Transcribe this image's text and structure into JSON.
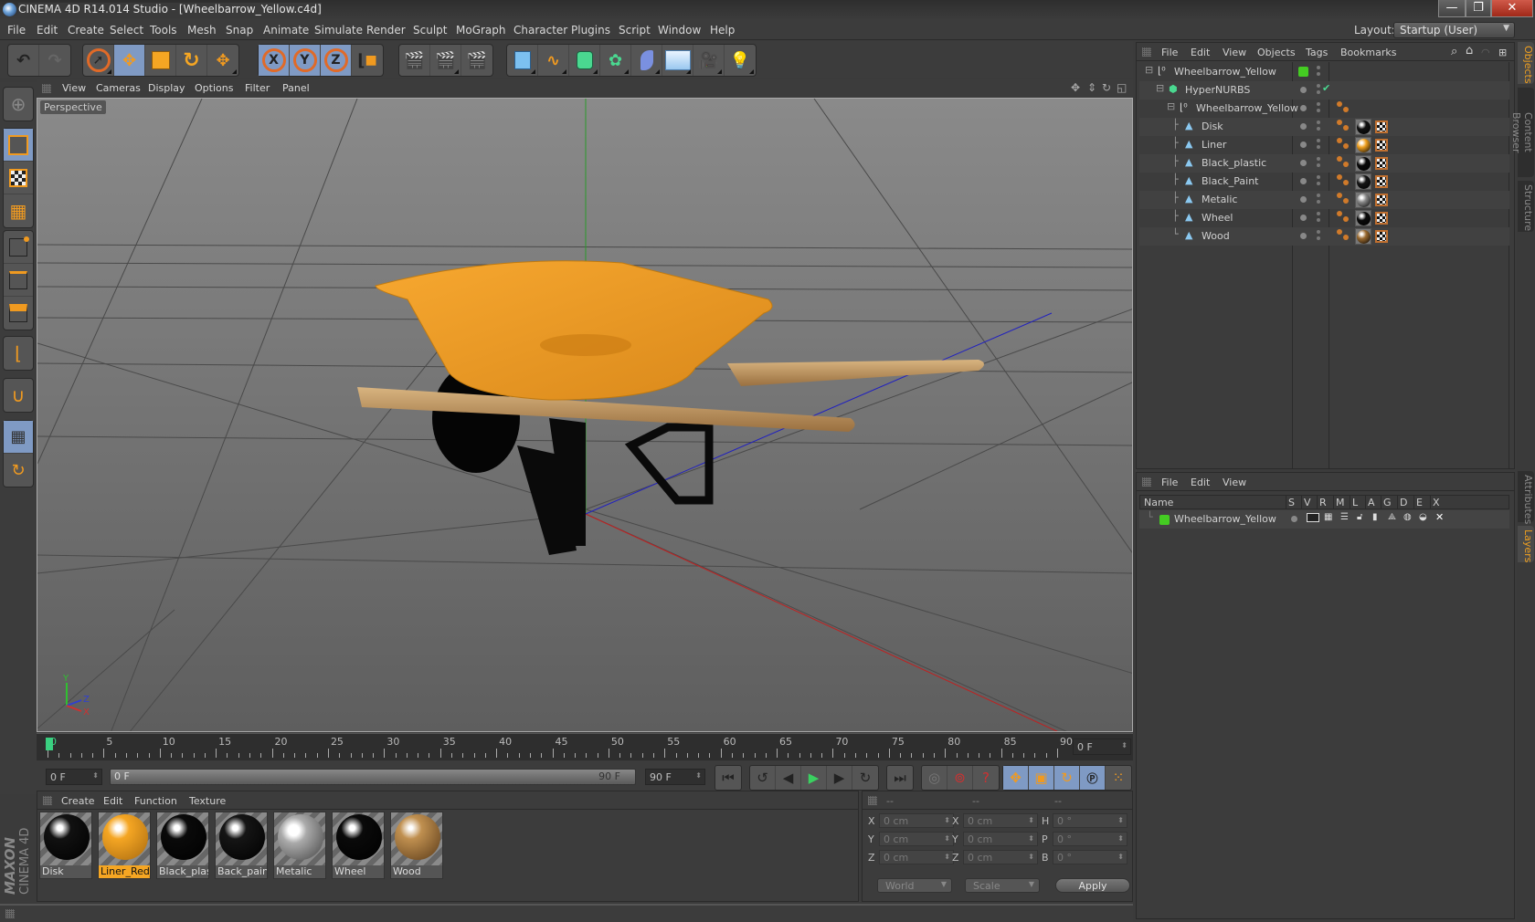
{
  "window": {
    "title": "CINEMA 4D R14.014 Studio - [Wheelbarrow_Yellow.c4d]",
    "buttons": {
      "minimize": "—",
      "maximize": "❐",
      "close": "✕"
    }
  },
  "menubar": {
    "items": [
      "File",
      "Edit",
      "Create",
      "Select",
      "Tools",
      "Mesh",
      "Snap",
      "Animate",
      "Simulate",
      "Render",
      "Sculpt",
      "MoGraph",
      "Character",
      "Plugins",
      "Script",
      "Window",
      "Help"
    ],
    "layout_label": "Layout:",
    "layout_value": "Startup (User)"
  },
  "toolbar": {
    "icons": [
      "undo-icon",
      "redo-icon",
      "live-selection-icon",
      "move-icon",
      "scale-icon",
      "rotate-icon",
      "recent-tool-icon",
      "x-axis-lock-icon",
      "y-axis-lock-icon",
      "z-axis-lock-icon",
      "coordinate-system-icon",
      "render-view-icon",
      "render-picture-viewer-icon",
      "edit-render-settings-icon",
      "cube-icon",
      "spline-icon",
      "hypernurbs-icon",
      "array-icon",
      "deformer-icon",
      "floor-icon",
      "camera-icon",
      "light-icon"
    ],
    "axis_labels": [
      "X",
      "Y",
      "Z"
    ]
  },
  "left_toolbar": {
    "icons": [
      "make-editable-icon",
      "model-mode-icon",
      "texture-mode-icon",
      "workplane-mode-icon",
      "points-mode-icon",
      "edges-mode-icon",
      "polygons-mode-icon",
      "axis-mode-icon",
      "snap-magnet-icon",
      "workplane-lock-icon",
      "workplane-rotate-icon"
    ]
  },
  "viewport": {
    "menu": [
      "View",
      "Cameras",
      "Display",
      "Options",
      "Filter",
      "Panel"
    ],
    "label": "Perspective",
    "axis_gizmo": {
      "y": "Y",
      "z": "Z",
      "x": "X"
    }
  },
  "timeline": {
    "ticks": [
      "0",
      "5",
      "10",
      "15",
      "20",
      "25",
      "30",
      "35",
      "40",
      "45",
      "50",
      "55",
      "60",
      "65",
      "70",
      "75",
      "80",
      "85",
      "90"
    ],
    "current_frame": "0 F"
  },
  "transport": {
    "start_field": "0 F",
    "range_start": "0 F",
    "range_end": "90 F",
    "end_field": "90 F"
  },
  "material_manager": {
    "menu": [
      "Create",
      "Edit",
      "Function",
      "Texture"
    ],
    "materials": [
      {
        "name": "Disk",
        "color": "#111111",
        "selected": false
      },
      {
        "name": "Liner_Red_(",
        "color": "#f0a020",
        "selected": true
      },
      {
        "name": "Black_plast",
        "color": "#0a0a0a",
        "selected": false
      },
      {
        "name": "Back_paint",
        "color": "#151515",
        "selected": false
      },
      {
        "name": "Metalic",
        "color": "#8a8a8a",
        "selected": false
      },
      {
        "name": "Wheel",
        "color": "#0a0a0a",
        "selected": false
      },
      {
        "name": "Wood",
        "color": "#9a6a30",
        "selected": false
      }
    ]
  },
  "coordinates": {
    "headers": [
      "--",
      "--",
      "--"
    ],
    "rows": [
      {
        "l1": "X",
        "v1": "0 cm",
        "l2": "X",
        "v2": "0 cm",
        "l3": "H",
        "v3": "0 °"
      },
      {
        "l1": "Y",
        "v1": "0 cm",
        "l2": "Y",
        "v2": "0 cm",
        "l3": "P",
        "v3": "0 °"
      },
      {
        "l1": "Z",
        "v1": "0 cm",
        "l2": "Z",
        "v2": "0 cm",
        "l3": "B",
        "v3": "0 °"
      }
    ],
    "mode": "World",
    "type": "Scale",
    "apply": "Apply"
  },
  "object_manager": {
    "menu": [
      "File",
      "Edit",
      "View",
      "Objects",
      "Tags",
      "Bookmarks"
    ],
    "objects": [
      {
        "name": "Wheelbarrow_Yellow",
        "type": "null",
        "depth": 0
      },
      {
        "name": "HyperNURBS",
        "type": "hypernurbs",
        "depth": 1
      },
      {
        "name": "Wheelbarrow_Yellow",
        "type": "null",
        "depth": 2
      },
      {
        "name": "Disk",
        "type": "polygon",
        "depth": 3,
        "mat": "#111111"
      },
      {
        "name": "Liner",
        "type": "polygon",
        "depth": 3,
        "mat": "#f0a020"
      },
      {
        "name": "Black_plastic",
        "type": "polygon",
        "depth": 3,
        "mat": "#0a0a0a"
      },
      {
        "name": "Black_Paint",
        "type": "polygon",
        "depth": 3,
        "mat": "#151515"
      },
      {
        "name": "Metalic",
        "type": "polygon",
        "depth": 3,
        "mat": "#8a8a8a"
      },
      {
        "name": "Wheel",
        "type": "polygon",
        "depth": 3,
        "mat": "#0a0a0a"
      },
      {
        "name": "Wood",
        "type": "polygon",
        "depth": 3,
        "mat": "#9a6a30"
      }
    ]
  },
  "layer_manager": {
    "menu": [
      "File",
      "Edit",
      "View"
    ],
    "columns": [
      "Name",
      "S",
      "V",
      "R",
      "M",
      "L",
      "A",
      "G",
      "D",
      "E",
      "X"
    ],
    "layers": [
      {
        "name": "Wheelbarrow_Yellow",
        "color": "#44cc22"
      }
    ]
  },
  "right_tabs": {
    "top": [
      "Objects",
      "Content Browser",
      "Structure"
    ],
    "bottom": [
      "Attributes",
      "Layers"
    ]
  },
  "brand": {
    "line1": "MAXON",
    "line2": "CINEMA 4D"
  },
  "colors": {
    "accent_orange": "#f0a020",
    "active_blue": "#7f9ac4",
    "layer_green": "#44cc22"
  }
}
